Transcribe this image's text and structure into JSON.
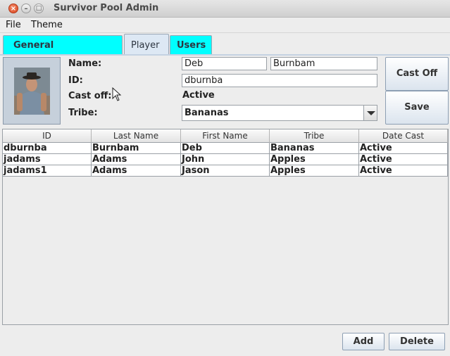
{
  "window": {
    "title": "Survivor Pool Admin"
  },
  "menu": {
    "file": "File",
    "theme": "Theme"
  },
  "tabs": {
    "general": "General",
    "player": "Player",
    "users": "Users"
  },
  "player": {
    "name_label": "Name:",
    "id_label": "ID:",
    "castoff_label": "Cast off:",
    "tribe_label": "Tribe:",
    "first_name": "Deb",
    "last_name": "Burnbam",
    "id": "dburnba",
    "castoff_status": "Active",
    "tribe": "Bananas"
  },
  "buttons": {
    "cast_off": "Cast Off",
    "save": "Save",
    "add": "Add",
    "delete": "Delete"
  },
  "table": {
    "headers": [
      "ID",
      "Last Name",
      "First Name",
      "Tribe",
      "Date Cast"
    ],
    "rows": [
      [
        "dburnba",
        "Burnbam",
        "Deb",
        "Bananas",
        "Active"
      ],
      [
        "jadams",
        "Adams",
        "John",
        "Apples",
        "Active"
      ],
      [
        "jadams1",
        "Adams",
        "Jason",
        "Apples",
        "Active"
      ]
    ]
  },
  "icons": {
    "close": "close-icon",
    "minimize": "minimize-icon",
    "maximize": "maximize-icon",
    "dropdown": "chevron-down-icon",
    "cursor": "mouse-pointer-icon"
  },
  "colors": {
    "tab_accent": "#00ffff",
    "selected_tab": "#dde8f4"
  }
}
